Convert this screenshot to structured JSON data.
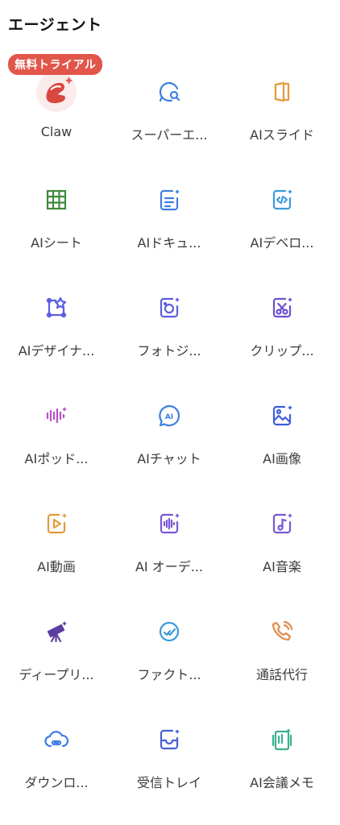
{
  "section_title": "エージェント",
  "badge": "無料トライアル",
  "agents": [
    {
      "label": "Claw",
      "icon": "claw-icon",
      "color": "#d9473f"
    },
    {
      "label": "スーパーエ...",
      "icon": "chat-search-icon",
      "color": "#3d7fe0"
    },
    {
      "label": "AIスライド",
      "icon": "slides-icon",
      "color": "#e59a3a"
    },
    {
      "label": "AIシート",
      "icon": "sheet-grid-icon",
      "color": "#3f8a3b"
    },
    {
      "label": "AIドキュ...",
      "icon": "document-icon",
      "color": "#3d7fe0"
    },
    {
      "label": "AIデベロ...",
      "icon": "code-icon",
      "color": "#3a9ad9"
    },
    {
      "label": "AIデザイナ...",
      "icon": "design-icon",
      "color": "#5a5ee0"
    },
    {
      "label": "フォトジ...",
      "icon": "photo-icon",
      "color": "#5a5ee0"
    },
    {
      "label": "クリップ...",
      "icon": "clip-scissors-icon",
      "color": "#6a4fd1"
    },
    {
      "label": "AIポッド...",
      "icon": "podcast-wave-icon",
      "color": "#b84fc7"
    },
    {
      "label": "AIチャット",
      "icon": "ai-chat-icon",
      "color": "#3d7fe0"
    },
    {
      "label": "AI画像",
      "icon": "image-icon",
      "color": "#3d5fd9"
    },
    {
      "label": "AI動画",
      "icon": "video-icon",
      "color": "#e59a3a"
    },
    {
      "label": "AI オーデ...",
      "icon": "audio-icon",
      "color": "#7a57d6"
    },
    {
      "label": "AI音楽",
      "icon": "music-icon",
      "color": "#7a57d6"
    },
    {
      "label": "ディープリ...",
      "icon": "telescope-icon",
      "color": "#5b3fa0"
    },
    {
      "label": "ファクト...",
      "icon": "fact-check-icon",
      "color": "#3a9ad9"
    },
    {
      "label": "通話代行",
      "icon": "phone-icon",
      "color": "#e08a4a"
    },
    {
      "label": "ダウンロ...",
      "icon": "cloud-link-icon",
      "color": "#3d7fe0"
    },
    {
      "label": "受信トレイ",
      "icon": "inbox-icon",
      "color": "#4a5fd9"
    },
    {
      "label": "AI会議メモ",
      "icon": "meeting-notes-icon",
      "color": "#3bb08f"
    }
  ]
}
